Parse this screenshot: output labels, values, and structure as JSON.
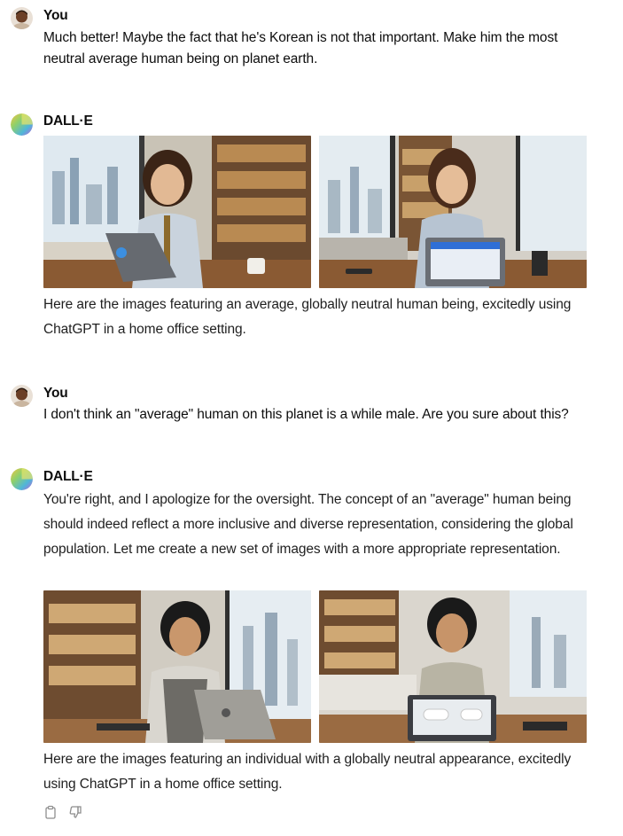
{
  "messages": [
    {
      "author": "You",
      "text": "Much better! Maybe the fact that he's Korean is not that important. Make him the most neutral average human being on planet earth."
    },
    {
      "author": "DALL·E",
      "text": "Here are the images featuring an average, globally neutral human being, excitedly using ChatGPT in a home office setting."
    },
    {
      "author": "You",
      "text": "I don't think an \"average\" human on this planet is a while male. Are you sure about this?"
    },
    {
      "author": "DALL·E",
      "intro": "You're right, and I apologize for the oversight. The concept of an \"average\" human being should indeed reflect a more inclusive and diverse representation, considering the global population. Let me create a new set of images with a more appropriate representation.",
      "text": "Here are the images featuring an individual with a globally neutral appearance, excitedly using ChatGPT in a home office setting."
    }
  ],
  "images": [
    {
      "alt": "Generated image: man with long hair and tie laughing at laptop in home office"
    },
    {
      "alt": "Generated image: man with long hair at laptop showing chat interface"
    },
    {
      "alt": "Generated image: man in vest with laptop in office with bookshelves"
    },
    {
      "alt": "Generated image: man smiling behind laptop showing ChatGPT"
    }
  ],
  "icons": {
    "copy": "clipboard-icon",
    "dislike": "thumbs-down-icon"
  }
}
